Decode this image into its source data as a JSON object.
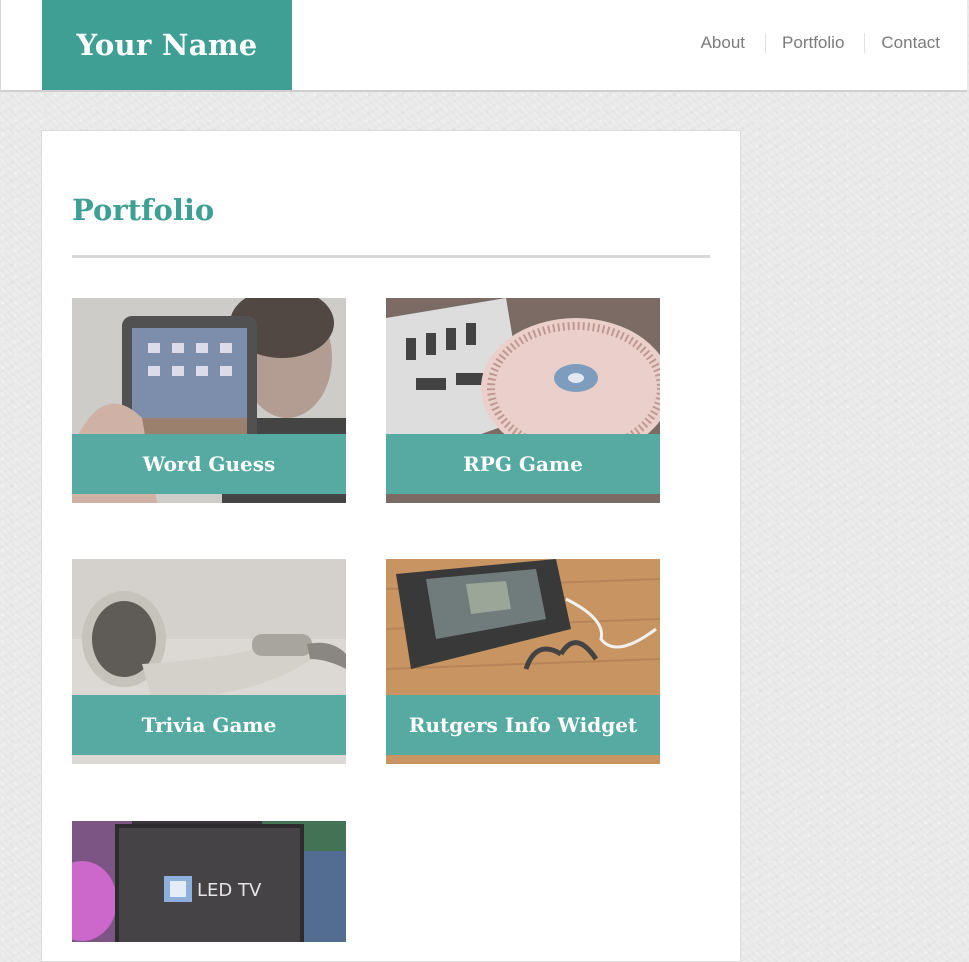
{
  "header": {
    "brand": "Your Name",
    "nav": [
      "About",
      "Portfolio",
      "Contact"
    ]
  },
  "main": {
    "title": "Portfolio",
    "projects": [
      {
        "label": "Word Guess",
        "image": "person-holding-tablet"
      },
      {
        "label": "RPG Game",
        "image": "dj-turntable"
      },
      {
        "label": "Trivia Game",
        "image": "earbuds"
      },
      {
        "label": "Rutgers Info Widget",
        "image": "phone-and-earphones-on-desk"
      },
      {
        "label": "",
        "image": "led-tv-screen"
      }
    ]
  },
  "colors": {
    "accent": "#3f9f95",
    "background": "#ececec",
    "card": "#ffffff",
    "nav_text": "#7b7b7b"
  }
}
